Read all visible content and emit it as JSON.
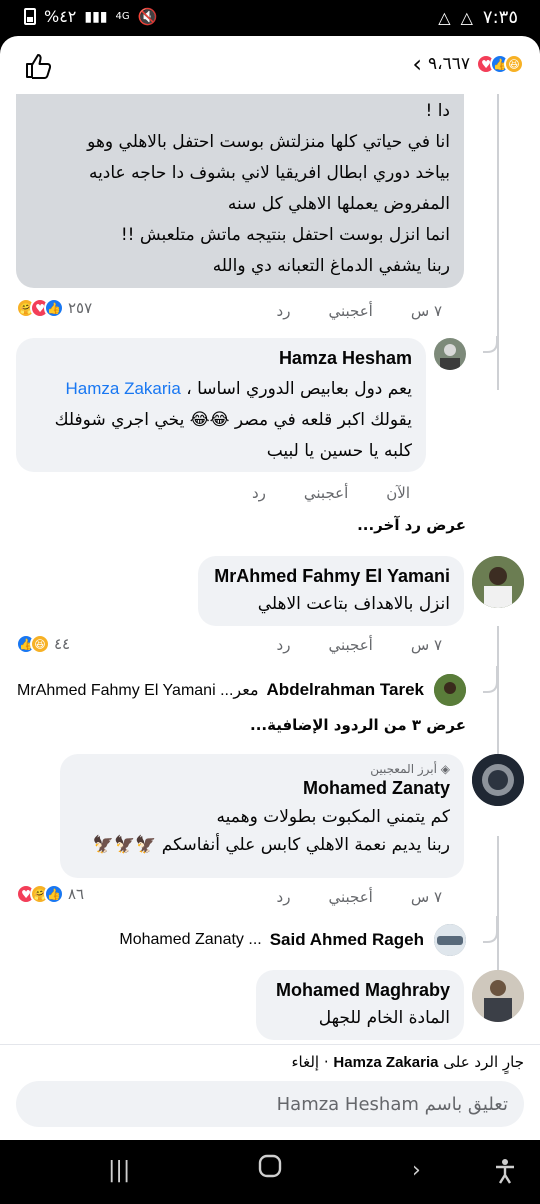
{
  "status": {
    "time": "٧:٣٥",
    "battery": "%٤٢",
    "network": "4G"
  },
  "header": {
    "reaction_count": "٩،٦٦٧"
  },
  "comments": [
    {
      "id": "c1",
      "lines": [
        "دا !",
        "انا في حياتي كلها منزلتش بوست احتفل بالاهلي وهو",
        "بياخد دوري ابطال افريقيا لاني بشوف دا حاجه عاديه",
        "المفروض يعملها الاهلي كل سنه",
        "انما انزل بوست احتفل بنتيجه ماتش متلعبش !!",
        "ربنا يشفي الدماغ التعبانه دي والله"
      ],
      "time": "٧ س",
      "like": "أعجبني",
      "reply": "رد",
      "reactions": "٢٥٧"
    },
    {
      "id": "c2",
      "name": "Hamza Hesham",
      "line1": "يعم دول بعابيص الدوري اساسا ،",
      "tag": "Hamza Zakaria",
      "line2": "يقولك اكبر قلعه في مصر 😂😂 يخي اجري شوفلك",
      "line3": "كلبه يا حسين يا لبيب",
      "time": "الآن",
      "like": "أعجبني",
      "reply": "رد"
    },
    {
      "id": "c3",
      "name": "MrAhmed Fahmy El Yamani",
      "text": "انزل بالاهداف بتاعت الاهلي",
      "time": "٧ س",
      "like": "أعجبني",
      "reply": "رد",
      "reactions": "٤٤"
    },
    {
      "id": "c4",
      "badge": "أبرز المعجبين",
      "name": "Mohamed Zanaty",
      "line1": "كم يتمني المكبوت بطولات وهميه",
      "line2": "ربنا يديم نعمة الاهلي كابس علي أنفاسكم 🦅🦅🦅",
      "time": "٧ س",
      "like": "أعجبني",
      "reply": "رد",
      "reactions": "٨٦"
    },
    {
      "id": "c5",
      "name": "Mohamed Maghraby",
      "text": "المادة الخام للجهل"
    }
  ],
  "links": {
    "more_reply": "عرض رد آخر...",
    "more_replies": "عرض ٣ من الردود الإضافية..."
  },
  "reply_previews": [
    {
      "author": "Abdelrahman Tarek",
      "preview": "معر... MrAhmed Fahmy El Yamani"
    },
    {
      "author": "Said Ahmed Rageh",
      "preview": "... Mohamed Zanaty"
    }
  ],
  "composer": {
    "replying_prefix": "جارٍ الرد على",
    "replying_to": "Hamza Zakaria",
    "cancel": "· إلغاء",
    "placeholder": "تعليق باسم Hamza Hesham"
  },
  "colors": {
    "link_blue": "#1877f2",
    "bubble": "#f0f2f5",
    "meta_gray": "#65676b"
  }
}
